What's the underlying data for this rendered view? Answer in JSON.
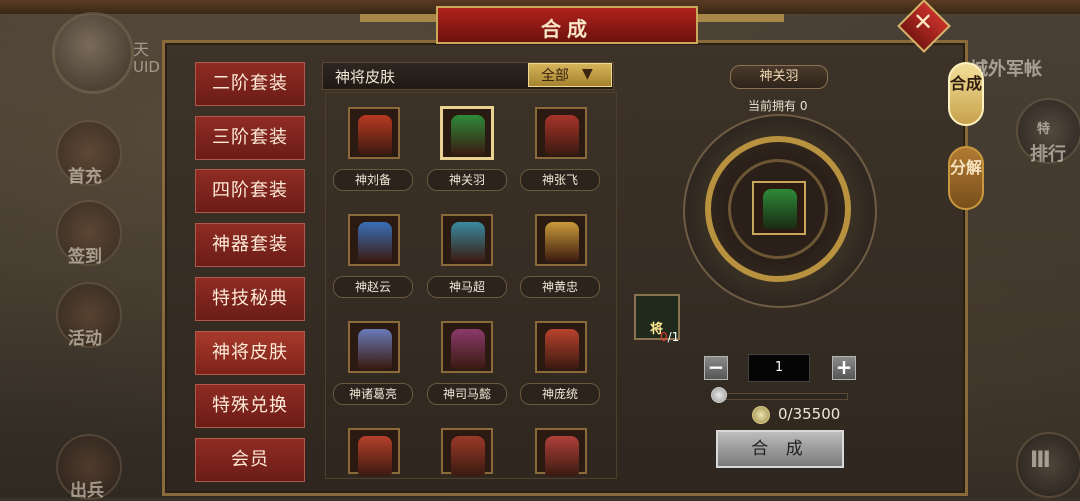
{
  "hud": {
    "player_name": "天",
    "uid_label": "UID"
  },
  "side_menu": [
    {
      "label": "首充"
    },
    {
      "label": "签到"
    },
    {
      "label": "活动"
    },
    {
      "label": "出兵"
    }
  ],
  "right_hud": {
    "camp_label": "城外军帐",
    "rank_label": "排行",
    "rank_badge": "特"
  },
  "dialog": {
    "title": "合成",
    "close_symbol": "✕",
    "categories": [
      {
        "label": "二阶套装"
      },
      {
        "label": "三阶套装"
      },
      {
        "label": "四阶套装"
      },
      {
        "label": "神器套装"
      },
      {
        "label": "特技秘典"
      },
      {
        "label": "神将皮肤",
        "selected": true
      },
      {
        "label": "特殊兑换"
      },
      {
        "label": "会员"
      }
    ],
    "list_title": "神将皮肤",
    "filter": {
      "value": "全部",
      "arrow": "▼"
    },
    "items": [
      {
        "name": "神刘备",
        "color": "#b83a22"
      },
      {
        "name": "神关羽",
        "color": "#2e8a3a",
        "selected": true
      },
      {
        "name": "神张飞",
        "color": "#a8342a"
      },
      {
        "name": "神赵云",
        "color": "#3a6fb8"
      },
      {
        "name": "神马超",
        "color": "#3a8aa0"
      },
      {
        "name": "神黄忠",
        "color": "#c99a3a"
      },
      {
        "name": "神诸葛亮",
        "color": "#6a7ab8"
      },
      {
        "name": "神司马懿",
        "color": "#8a3a6a"
      },
      {
        "name": "神庞统",
        "color": "#b8432e"
      },
      {
        "name": "",
        "color": "#b5402a"
      },
      {
        "name": "",
        "color": "#9a3a28"
      },
      {
        "name": "",
        "color": "#b0403a"
      }
    ],
    "detail": {
      "name": "神关羽",
      "owned_text": "当前拥有 0",
      "material": {
        "have": "0",
        "need": "/1",
        "badge": "将"
      },
      "quantity": "1",
      "minus": "−",
      "plus": "+",
      "cost": "0/35500",
      "craft_label": "合 成",
      "tabs": [
        {
          "label": "合成",
          "active": true
        },
        {
          "label": "分解",
          "active": false
        }
      ]
    }
  }
}
